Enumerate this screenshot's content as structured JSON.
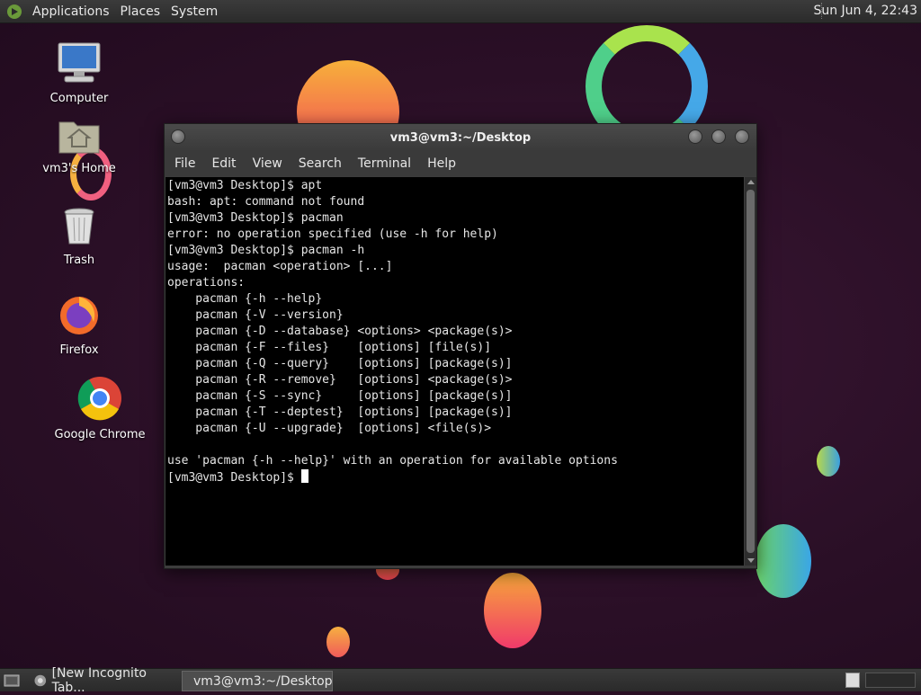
{
  "top_panel": {
    "menus": [
      "Applications",
      "Places",
      "System"
    ],
    "clock": "Sun Jun  4, 22:43"
  },
  "desktop_icons": {
    "computer": "Computer",
    "home": "vm3's Home",
    "trash": "Trash",
    "firefox": "Firefox",
    "chrome": "Google Chrome"
  },
  "terminal": {
    "title": "vm3@vm3:~/Desktop",
    "menu": [
      "File",
      "Edit",
      "View",
      "Search",
      "Terminal",
      "Help"
    ],
    "lines": [
      "[vm3@vm3 Desktop]$ apt",
      "bash: apt: command not found",
      "[vm3@vm3 Desktop]$ pacman",
      "error: no operation specified (use -h for help)",
      "[vm3@vm3 Desktop]$ pacman -h",
      "usage:  pacman <operation> [...]",
      "operations:",
      "    pacman {-h --help}",
      "    pacman {-V --version}",
      "    pacman {-D --database} <options> <package(s)>",
      "    pacman {-F --files}    [options] [file(s)]",
      "    pacman {-Q --query}    [options] [package(s)]",
      "    pacman {-R --remove}   [options] <package(s)>",
      "    pacman {-S --sync}     [options] [package(s)]",
      "    pacman {-T --deptest}  [options] [package(s)]",
      "    pacman {-U --upgrade}  [options] <file(s)>",
      "",
      "use 'pacman {-h --help}' with an operation for available options"
    ],
    "prompt": "[vm3@vm3 Desktop]$ "
  },
  "taskbar": {
    "tasks": [
      "[New Incognito Tab...",
      "vm3@vm3:~/Desktop"
    ]
  }
}
